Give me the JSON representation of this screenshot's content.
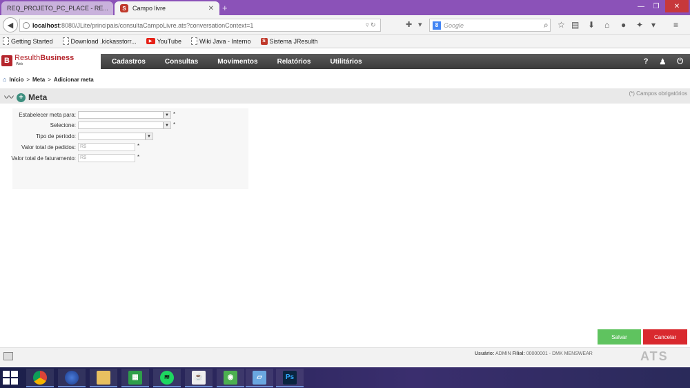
{
  "browser": {
    "tabs": [
      {
        "label": "REQ_PROJETO_PC_PLACE - RE..."
      },
      {
        "label": "Campo livre"
      }
    ],
    "url_host": "localhost",
    "url_rest": ":8080/JLite/principais/consultaCampoLivre.ats?conversationContext=1",
    "search_placeholder": "Google",
    "bookmarks": [
      {
        "label": "Getting Started"
      },
      {
        "label": "Download .kickasstorr..."
      },
      {
        "label": "YouTube"
      },
      {
        "label": "Wiki Java - Interno"
      },
      {
        "label": "Sistema JResulth"
      }
    ]
  },
  "app": {
    "logo_prefix": "Resulth",
    "logo_suffix": "Business",
    "logo_sub": "Web",
    "menu": [
      {
        "label": "Cadastros"
      },
      {
        "label": "Consultas"
      },
      {
        "label": "Movimentos"
      },
      {
        "label": "Relatórios"
      },
      {
        "label": "Utilitários"
      }
    ],
    "help_label": "?"
  },
  "breadcrumb": {
    "home": "Início",
    "items": [
      "Meta",
      "Adicionar meta"
    ]
  },
  "page": {
    "title": "Meta",
    "required_note": "(*) Campos obrigatórios"
  },
  "form": {
    "fields": [
      {
        "label": "Estabelecer meta para:",
        "type": "select",
        "value": "",
        "required": "*"
      },
      {
        "label": "Selecione:",
        "type": "select",
        "value": "",
        "required": "*"
      },
      {
        "label": "Tipo de período:",
        "type": "select",
        "value": "",
        "required": ""
      },
      {
        "label": "Valor total de pedidos:",
        "type": "input",
        "placeholder": "R$",
        "required": "*"
      },
      {
        "label": "Valor total de faturamento:",
        "type": "input",
        "placeholder": "R$",
        "required": "*"
      }
    ]
  },
  "actions": {
    "save": "Salvar",
    "cancel": "Cancelar"
  },
  "status": {
    "user_label": "Usuário:",
    "user": "ADMIN",
    "branch_label": "Filial:",
    "branch": "00000001 - DMK MENSWEAR",
    "brand": "ATS"
  },
  "taskbar": {
    "apps": [
      "chrome",
      "firefox",
      "file-explorer",
      "store",
      "spotify",
      "java",
      "evernote",
      "notes",
      "photoshop"
    ],
    "photoshop_label": "Ps"
  }
}
